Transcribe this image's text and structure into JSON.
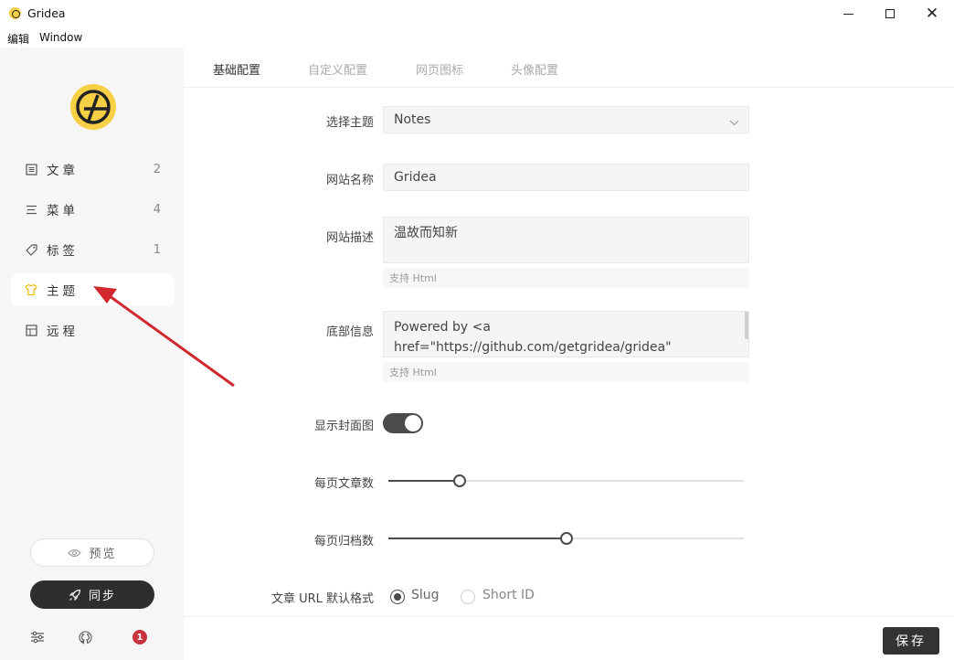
{
  "window": {
    "title": "Gridea",
    "minimize": "—",
    "close": "✕"
  },
  "menubar": {
    "items": [
      "编辑",
      "Window"
    ]
  },
  "sidebar": {
    "items": [
      {
        "label": "文章",
        "count": "2",
        "icon": "article-icon"
      },
      {
        "label": "菜单",
        "count": "4",
        "icon": "menu-icon"
      },
      {
        "label": "标签",
        "count": "1",
        "icon": "tag-icon"
      },
      {
        "label": "主题",
        "count": "",
        "icon": "theme-icon",
        "active": true
      },
      {
        "label": "远程",
        "count": "",
        "icon": "remote-icon"
      }
    ],
    "preview_label": "预览",
    "sync_label": "同步",
    "notification_count": "1"
  },
  "tabs": [
    {
      "label": "基础配置",
      "active": true
    },
    {
      "label": "自定义配置",
      "active": false
    },
    {
      "label": "网页图标",
      "active": false
    },
    {
      "label": "头像配置",
      "active": false
    }
  ],
  "form": {
    "theme": {
      "label": "选择主题",
      "value": "Notes"
    },
    "site_name": {
      "label": "网站名称",
      "value": "Gridea"
    },
    "site_description": {
      "label": "网站描述",
      "value": "温故而知新",
      "hint": "支持 Html"
    },
    "footer_info": {
      "label": "底部信息",
      "value": "Powered by <a\nhref=\"https://github.com/getgridea/gridea\"",
      "hint": "支持 Html"
    },
    "show_cover": {
      "label": "显示封面图",
      "enabled": true
    },
    "posts_per_page": {
      "label": "每页文章数",
      "fraction": 0.2
    },
    "archives_per_page": {
      "label": "每页归档数",
      "fraction": 0.5
    },
    "url_format": {
      "label": "文章 URL 默认格式",
      "options": [
        "Slug",
        "Short ID"
      ],
      "selected": "Slug"
    }
  },
  "footer": {
    "save_label": "保存"
  },
  "colors": {
    "accent": "#f7d046",
    "dark": "#2e2e2e",
    "sidebar_bg": "#f6f6f6",
    "badge": "#c8323c",
    "annotation": "#d0282e"
  }
}
